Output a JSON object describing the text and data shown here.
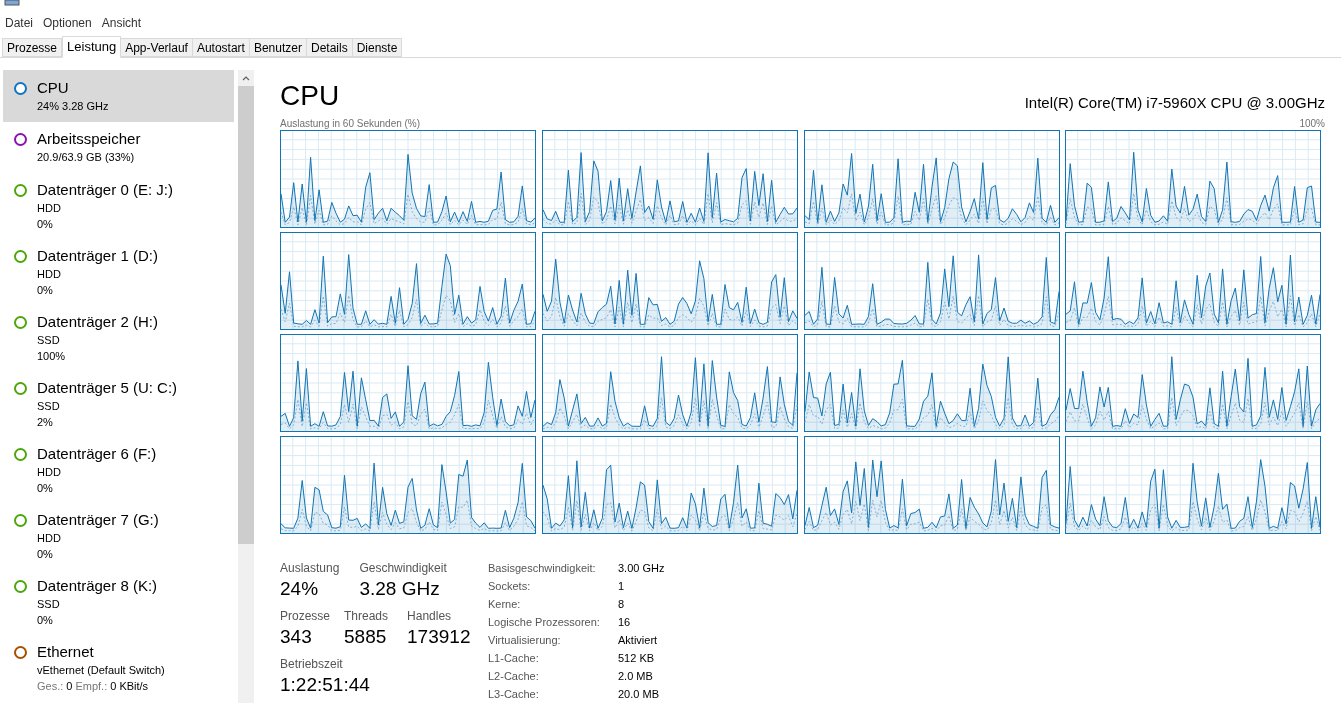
{
  "menu": [
    "Datei",
    "Optionen",
    "Ansicht"
  ],
  "tabs": [
    {
      "label": "Prozesse",
      "selected": false
    },
    {
      "label": "Leistung",
      "selected": true
    },
    {
      "label": "App-Verlauf",
      "selected": false
    },
    {
      "label": "Autostart",
      "selected": false
    },
    {
      "label": "Benutzer",
      "selected": false
    },
    {
      "label": "Details",
      "selected": false
    },
    {
      "label": "Dienste",
      "selected": false
    }
  ],
  "sidebar": {
    "items": [
      {
        "name": "CPU",
        "color": "#1174c2",
        "lines": [
          "24% 3.28 GHz"
        ],
        "selected": true
      },
      {
        "name": "Arbeitsspeicher",
        "color": "#8b12ae",
        "lines": [
          "20.9/63.9 GB (33%)"
        ],
        "selected": false
      },
      {
        "name": "Datenträger 0 (E: J:)",
        "color": "#4da60c",
        "lines": [
          "HDD",
          "0%"
        ],
        "selected": false
      },
      {
        "name": "Datenträger 1 (D:)",
        "color": "#4da60c",
        "lines": [
          "HDD",
          "0%"
        ],
        "selected": false
      },
      {
        "name": "Datenträger 2 (H:)",
        "color": "#4da60c",
        "lines": [
          "SSD",
          "100%"
        ],
        "selected": false
      },
      {
        "name": "Datenträger 5 (U: C:)",
        "color": "#4da60c",
        "lines": [
          "SSD",
          "2%"
        ],
        "selected": false
      },
      {
        "name": "Datenträger 6 (F:)",
        "color": "#4da60c",
        "lines": [
          "HDD",
          "0%"
        ],
        "selected": false
      },
      {
        "name": "Datenträger 7 (G:)",
        "color": "#4da60c",
        "lines": [
          "HDD",
          "0%"
        ],
        "selected": false
      },
      {
        "name": "Datenträger 8 (K:)",
        "color": "#4da60c",
        "lines": [
          "SSD",
          "0%"
        ],
        "selected": false
      },
      {
        "name": "Ethernet",
        "color": "#a74f01",
        "lines": [
          "vEthernet (Default Switch)"
        ],
        "rates": [
          {
            "label": "Ges.:",
            "value": "0"
          },
          {
            "label": "Empf.:",
            "value": "0 KBit/s"
          }
        ],
        "selected": false
      }
    ]
  },
  "main": {
    "title": "CPU",
    "model": "Intel(R) Core(TM) i7-5960X CPU @ 3.00GHz",
    "graph_label": "Auslastung in 60 Sekunden (%)",
    "graph_max": "100%",
    "stats": [
      {
        "label": "Auslastung",
        "value": "24%"
      },
      {
        "label": "Geschwindigkeit",
        "value": "3.28 GHz"
      }
    ],
    "counts": [
      {
        "label": "Prozesse",
        "value": "343"
      },
      {
        "label": "Threads",
        "value": "5885"
      },
      {
        "label": "Handles",
        "value": "173912"
      }
    ],
    "uptime": {
      "label": "Betriebszeit",
      "value": "1:22:51:44"
    },
    "details": [
      {
        "label": "Basisgeschwindigkeit:",
        "value": "3.00 GHz"
      },
      {
        "label": "Sockets:",
        "value": "1"
      },
      {
        "label": "Kerne:",
        "value": "8"
      },
      {
        "label": "Logische Prozessoren:",
        "value": "16"
      },
      {
        "label": "Virtualisierung:",
        "value": "Aktiviert"
      },
      {
        "label": "L1-Cache:",
        "value": "512 KB"
      },
      {
        "label": "L2-Cache:",
        "value": "2.0 MB"
      },
      {
        "label": "L3-Cache:",
        "value": "20.0 MB"
      }
    ]
  }
}
